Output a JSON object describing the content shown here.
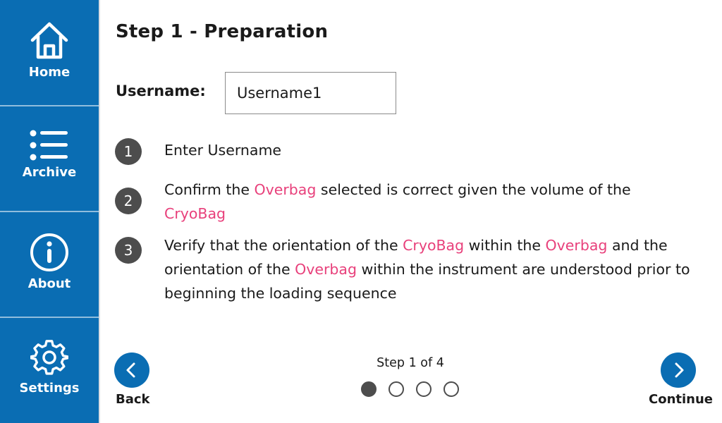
{
  "sidebar": {
    "items": [
      {
        "label": "Home",
        "icon": "home-icon"
      },
      {
        "label": "Archive",
        "icon": "list-icon"
      },
      {
        "label": "About",
        "icon": "info-icon"
      },
      {
        "label": "Settings",
        "icon": "gear-icon"
      }
    ],
    "background_color": "#0a6db3"
  },
  "main": {
    "title": "Step 1 - Preparation",
    "username_label": "Username:",
    "username_value": "Username1",
    "steps": [
      {
        "number": "1",
        "parts": [
          "Enter Username"
        ]
      },
      {
        "number": "2",
        "parts": [
          "Confirm the ",
          "Overbag",
          " selected is correct given the volume of the ",
          "CryoBag"
        ]
      },
      {
        "number": "3",
        "parts": [
          "Verify that the orientation of the ",
          "CryoBag",
          " within the ",
          "Overbag",
          " and the orientation of the ",
          "Overbag",
          " within the instrument are understood prior to beginning the loading sequence"
        ]
      }
    ],
    "highlight_color": "#e8407b"
  },
  "footer": {
    "back_label": "Back",
    "continue_label": "Continue",
    "step_counter": "Step 1 of 4",
    "current_step": 1,
    "total_steps": 4
  }
}
